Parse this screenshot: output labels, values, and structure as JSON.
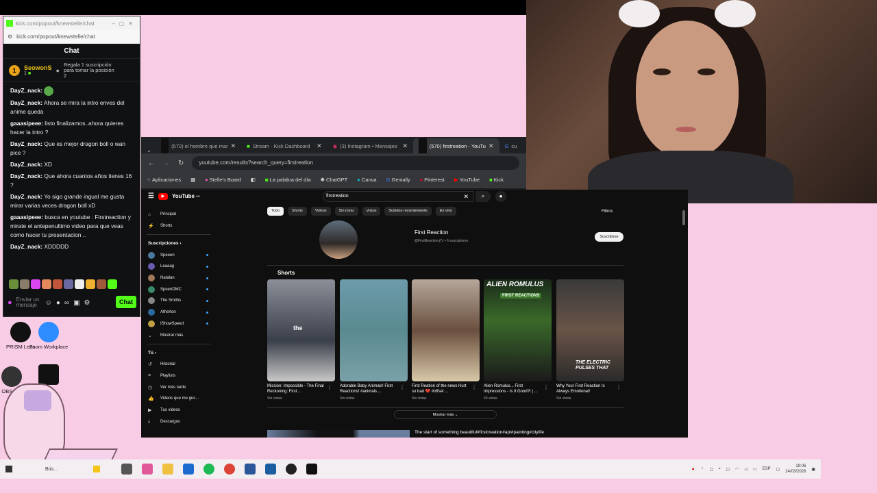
{
  "kick": {
    "window_title": "kick.com/popout/knewstelle/chat",
    "url": "kick.com/popout/knewstelle/chat",
    "chat_title": "Chat",
    "gift": {
      "rank": "1",
      "user": "SeowonS",
      "count": "1",
      "text": "Regala 1 suscripción para tomar la posición 2"
    },
    "messages": [
      {
        "user": "DayZ_nack:",
        "text": ""
      },
      {
        "user": "DayZ_nack:",
        "text": "Ahora se mira la intro enves del anime queda"
      },
      {
        "user": "gaaasipeee:",
        "text": "listo finalizamos..ahora quieres hacer la intro ?"
      },
      {
        "user": "DayZ_nack:",
        "text": "Que es mejor dragon boll o wan pice ?"
      },
      {
        "user": "DayZ_nack:",
        "text": "XD"
      },
      {
        "user": "DayZ_nack:",
        "text": "Que ahora cuantos años tienes 16 ?"
      },
      {
        "user": "DayZ_nack:",
        "text": "Yo sigo grande ingual me gusta mirar varias veces dragon boll xD"
      },
      {
        "user": "gaaasipeee:",
        "text": "busca en youtube : Firstreaction y mirate el antepenultimo video para que veas como hacer tu presentacion .."
      },
      {
        "user": "DayZ_nack:",
        "text": "XDDDDD"
      }
    ],
    "input_placeholder": "Enviar un mensaje",
    "chat_button": "Chat",
    "infinity": "∞"
  },
  "desktop_icons": [
    {
      "label": "PRISM Lens"
    },
    {
      "label": "Zoom Workplace"
    },
    {
      "label": "OBS S..."
    }
  ],
  "browser": {
    "tabs": [
      {
        "label": "(570) el hombre que mar"
      },
      {
        "label": "Stream · Kick Dashboard"
      },
      {
        "label": "(3) Instagram • Mensajes"
      },
      {
        "label": "(570) firstreation - YouTu"
      },
      {
        "label": "cu"
      }
    ],
    "url": "youtube.com/results?search_query=firstreation",
    "bookmarks": [
      "Aplicaciones",
      "Stelle's Board",
      "La palabra del día",
      "ChatGPT",
      "Canva",
      "Genially",
      "Pinterest",
      "YouTube",
      "Kick"
    ]
  },
  "youtube": {
    "logo": "YouTube",
    "country": "HN",
    "search_value": "firstreation",
    "sidebar": {
      "home": "Principal",
      "shorts": "Shorts",
      "subs_header": "Suscripciones",
      "subs": [
        "Speeen",
        "Leaaag",
        "Natalan",
        "SpeenDMC",
        "The Smiths",
        "Atherton",
        "IShowSpeed"
      ],
      "show_more": "Mostrar más",
      "you_header": "Tú",
      "you_items": [
        "Historial",
        "Playlists",
        "Ver más tarde",
        "Videos que me gus...",
        "Tus videos",
        "Descargas"
      ]
    },
    "chips": [
      "Todo",
      "Shorts",
      "Videos",
      "Sin mirar",
      "Vistos",
      "Subidos recientemente",
      "En vivo"
    ],
    "filters": "Filtros",
    "channel": {
      "name": "First Reaction",
      "handle": "@FirstReaction-j7c • 6 suscriptores",
      "subscribe": "Suscribirse"
    },
    "shorts_header": "Shorts",
    "shorts": [
      {
        "title": "Mission: Impossible - The Final Reckoning: First ...",
        "views": "Sin vistas",
        "overlay": "the"
      },
      {
        "title": "Adorable Baby Animals! First Reactions! #animals ...",
        "views": "Sin vistas",
        "overlay": ""
      },
      {
        "title": "First Reation of the news Hurt so bad 💔 #offset ...",
        "views": "Sin vistas",
        "overlay": ""
      },
      {
        "title": "Alien Romulus... First Impressions - Is It Good?! | ...",
        "views": "69 vistas",
        "overlay": "ALIEN ROMULUS"
      },
      {
        "title": "Why Your First Reaction Is Always Emotional!",
        "views": "Sin vistas",
        "overlay": "THE ELECTRIC PULSES THAT"
      }
    ],
    "shorts_badge": "FIRST REACTIONS",
    "show_more_btn": "Mostrar más",
    "next_title": "The start of something beautiful#firstcreation#apt#painting#citylife"
  },
  "taskbar": {
    "search_label": "Bús...",
    "lang": "ESP",
    "time": "19:06",
    "date": "24/03/2026"
  }
}
